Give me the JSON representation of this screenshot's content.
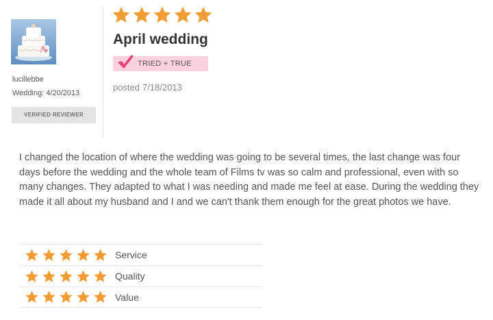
{
  "colors": {
    "star": "#f39c33",
    "badge_bg": "#fbd0df",
    "check": "#e8407a",
    "verified_bg": "#e4e4e4",
    "title": "#333333",
    "text": "#555555"
  },
  "reviewer": {
    "avatar_icon": "wedding-cake-icon",
    "username": "lucillebbe",
    "wedding_label": "Wedding:",
    "wedding_date": "4/20/2013",
    "verified_label": "VERIFIED REVIEWER"
  },
  "review": {
    "overall_rating": 5,
    "overall_max": 5,
    "title": "April wedding",
    "badge_icon": "checkmark-icon",
    "badge_label": "TRIED + TRUE",
    "posted_label": "posted",
    "posted_date": "7/18/2013",
    "body": "I changed the location of where the wedding was going to be several times, the last change was four days before the wedding and the whole team of Films tv was so calm and professional, even with so many changes. They adapted to what I was needing and made me feel at ease. During the wedding they made it all about my husband and I and we can't thank them enough for the great photos we have."
  },
  "sub_ratings": [
    {
      "label": "Service",
      "rating": 5,
      "max": 5
    },
    {
      "label": "Quality",
      "rating": 5,
      "max": 5
    },
    {
      "label": "Value",
      "rating": 5,
      "max": 5
    }
  ]
}
